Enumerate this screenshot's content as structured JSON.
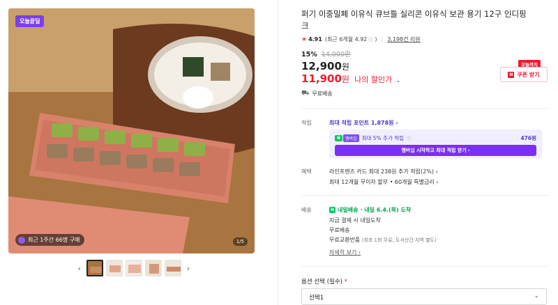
{
  "gallery": {
    "badge": "오늘끝딜",
    "purchase_text": "최근 1주간 66명 구매",
    "page_indicator": "1/5",
    "prev_icon": "chevron-left-icon",
    "next_icon": "chevron-right-icon"
  },
  "product": {
    "title": "퍼기 이중밀폐 이유식 큐브틀 실리콘 이유식 보관 용기 12구 인디핑크",
    "rating": "4.91",
    "rating_detail": "(최근 6개월 4.92",
    "rating_detail_close": ")",
    "review_count": "3,198건 리뷰",
    "discount_pct": "15%",
    "original_price": "14,000원",
    "price": "12,900",
    "price_unit": "원",
    "member_price": "11,900",
    "member_price_unit": "원",
    "member_label": "나의 할인가",
    "coupon_tag": "오늘까지",
    "coupon_button": "쿠폰 받기",
    "shipping": "무료배송"
  },
  "accrual": {
    "label": "적립",
    "max_points": "최대 적립 포인트 1,878원",
    "extra_badge": "멤버십",
    "extra_text": "최대 5% 추가 적립",
    "extra_amount": "476원",
    "cta": "멤버십 시작하고 최대 적립 받기"
  },
  "benefits": {
    "label": "혜택",
    "line1": "라인프렌즈 카드 최대 238원 추가 적립(2%)",
    "line2": "최대 12개월 무이자 할부 • 60개월 특별금리"
  },
  "delivery": {
    "label": "배송",
    "tag": "내일배송",
    "arrival": "· 내일 6.4.(목) 도착",
    "line1": "지금 결제 시 내일도착",
    "line2": "무료배송",
    "line3": "무료교환반품",
    "line3_note": "(최초 1회 무료, 도서산간 지역 별도)",
    "detail_link": "자세히 보기"
  },
  "option": {
    "label": "옵션 선택",
    "required": "(필수)",
    "required_mark": "*",
    "selected": "선택1"
  },
  "colors": {
    "accent_red": "#f0192e",
    "membership_purple": "#7b2ff2",
    "naver_green": "#03c75a"
  }
}
